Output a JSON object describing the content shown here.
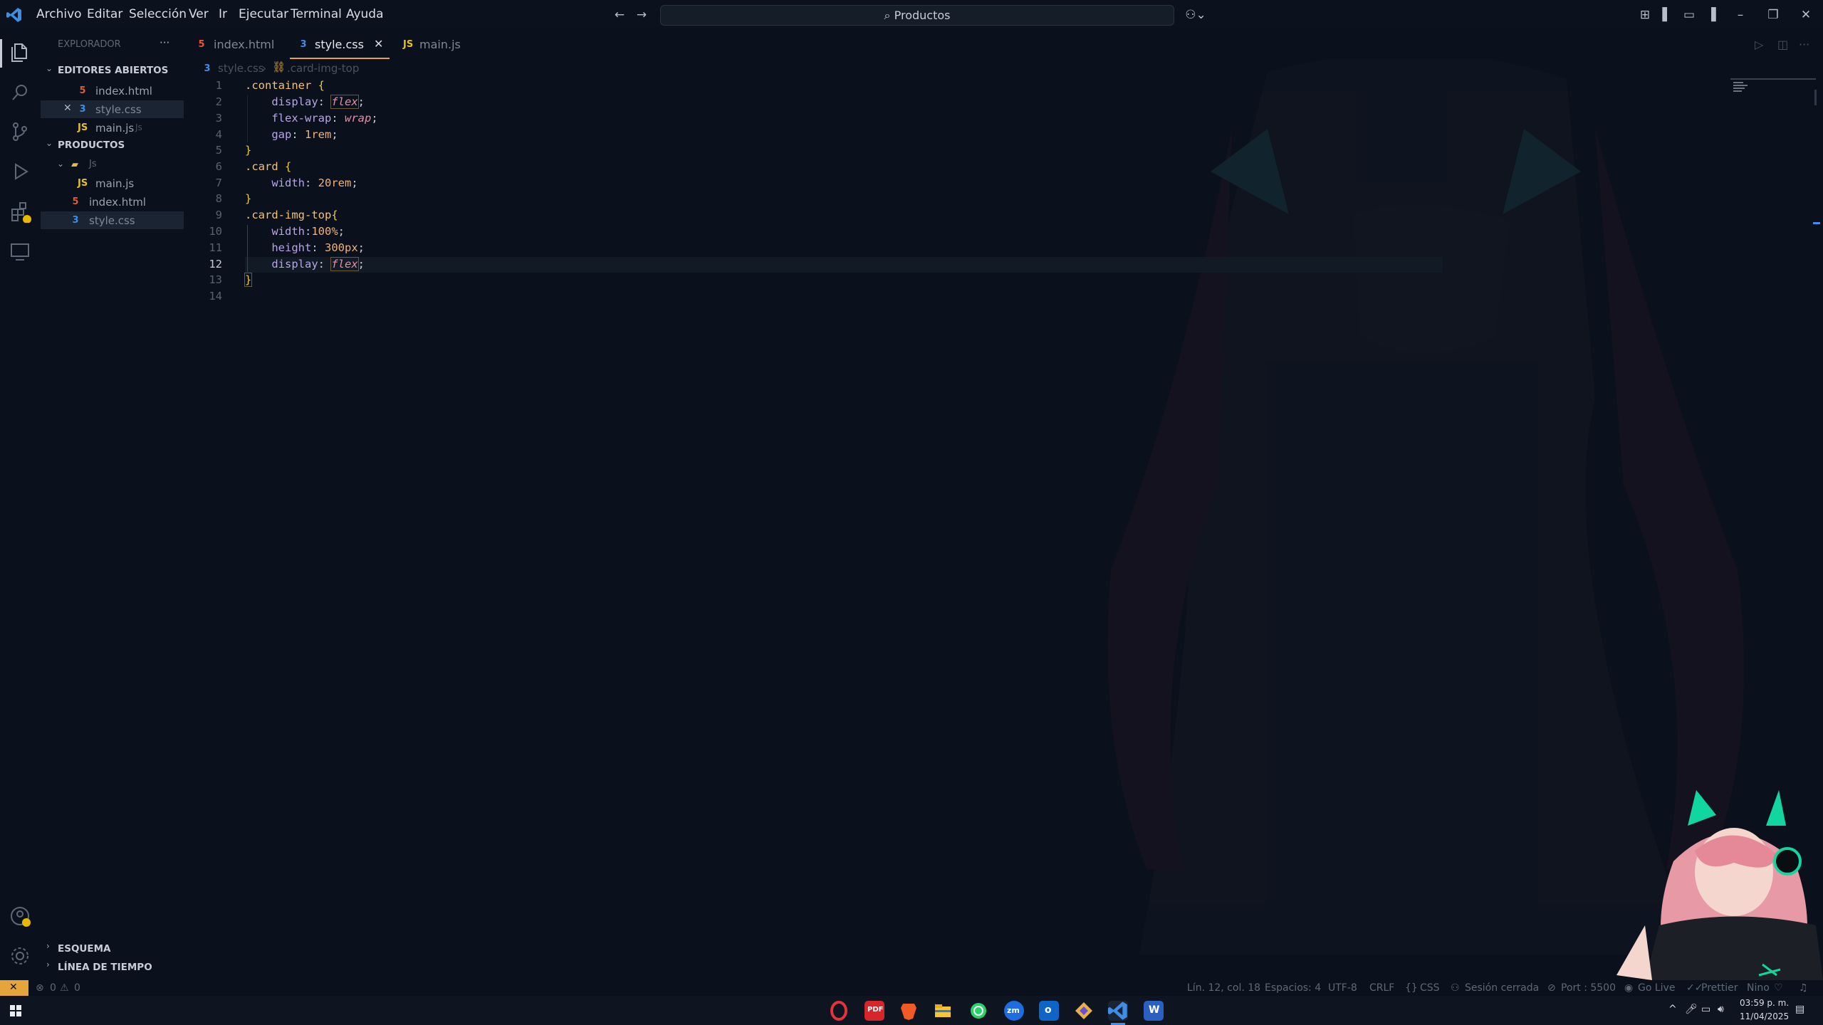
{
  "menu": [
    "Archivo",
    "Editar",
    "Selección",
    "Ver",
    "Ir",
    "Ejecutar",
    "Terminal",
    "Ayuda"
  ],
  "search": {
    "label": "Productos"
  },
  "sidebar": {
    "title": "EXPLORADOR",
    "open_editors_header": "EDITORES ABIERTOS",
    "open_editors": [
      {
        "name": "index.html",
        "type": "html"
      },
      {
        "name": "style.css",
        "type": "css"
      },
      {
        "name": "main.js",
        "type": "js",
        "hint": "Js"
      }
    ],
    "project_header": "PRODUCTOS",
    "tree": [
      {
        "name": "Js",
        "type": "folder"
      },
      {
        "name": "main.js",
        "type": "js"
      },
      {
        "name": "index.html",
        "type": "html"
      },
      {
        "name": "style.css",
        "type": "css"
      }
    ],
    "outline_header": "ESQUEMA",
    "timeline_header": "LÍNEA DE TIEMPO"
  },
  "tabs": [
    {
      "label": "index.html",
      "type": "html",
      "active": false
    },
    {
      "label": "style.css",
      "type": "css",
      "active": true
    },
    {
      "label": "main.js",
      "type": "js",
      "active": false
    }
  ],
  "breadcrumb": {
    "file": "style.css",
    "symbol": ".card-img-top"
  },
  "code_lines": [
    ".container {",
    "    display: flex;",
    "    flex-wrap: wrap;",
    "    gap: 1rem;",
    "}",
    ".card {",
    "    width: 20rem;",
    "}",
    ".card-img-top{",
    "    width:100%;",
    "    height: 300px;",
    "    display: flex;",
    "}",
    ""
  ],
  "current_line": 12,
  "status": {
    "errors": "0",
    "warnings": "0",
    "position": "Lín. 12, col. 18",
    "spaces": "Espacios: 4",
    "encoding": "UTF-8",
    "eol": "CRLF",
    "language": "CSS",
    "session": "Sesión cerrada",
    "port": "Port : 5500",
    "golive": "Go Live",
    "prettier": "Prettier",
    "user": "Nino"
  },
  "clock": {
    "time": "03:59 p. m.",
    "date": "11/04/2025"
  },
  "colors": {
    "accent": "#3e8ee6",
    "html": "#e8582a",
    "css": "#3e8ee6",
    "js": "#e6c02a",
    "background": "#0b111c"
  }
}
